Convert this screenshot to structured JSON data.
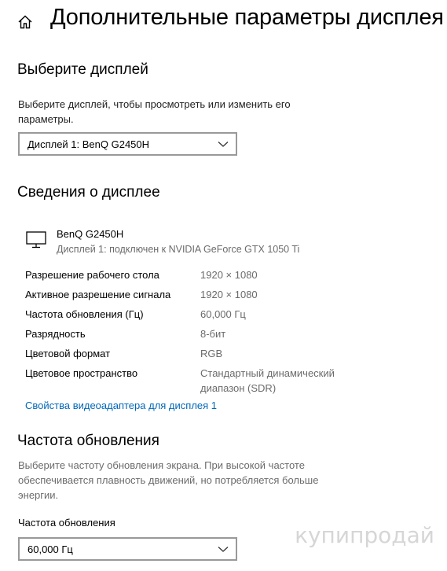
{
  "header": {
    "home_icon": "home-icon",
    "title": "Дополнительные параметры дисплея"
  },
  "select_display": {
    "heading": "Выберите дисплей",
    "description": "Выберите дисплей, чтобы просмотреть или изменить его параметры.",
    "dropdown_value": "Дисплей 1: BenQ G2450H"
  },
  "display_info": {
    "heading": "Сведения о дисплее",
    "monitor_icon": "monitor-icon",
    "monitor_name": "BenQ G2450H",
    "monitor_sub": "Дисплей 1: подключен к NVIDIA GeForce GTX 1050 Ti",
    "rows": [
      {
        "label": "Разрешение рабочего стола",
        "value": "1920 × 1080"
      },
      {
        "label": "Активное разрешение сигнала",
        "value": "1920 × 1080"
      },
      {
        "label": "Частота обновления (Гц)",
        "value": "60,000 Гц"
      },
      {
        "label": "Разрядность",
        "value": "8-бит"
      },
      {
        "label": "Цветовой формат",
        "value": "RGB"
      },
      {
        "label": "Цветовое пространство",
        "value": "Стандартный динамический диапазон (SDR)"
      }
    ],
    "adapter_link": "Свойства видеоадаптера для дисплея 1"
  },
  "refresh_rate": {
    "heading": "Частота обновления",
    "description": "Выберите частоту обновления экрана. При высокой частоте обеспечивается плавность движений, но потребляется больше энергии.",
    "field_label": "Частота обновления",
    "dropdown_value": "60,000 Гц"
  },
  "watermark": "купипродай",
  "colors": {
    "link": "#0067b8",
    "muted_text": "#6b6b6b",
    "dropdown_border": "#999999"
  }
}
